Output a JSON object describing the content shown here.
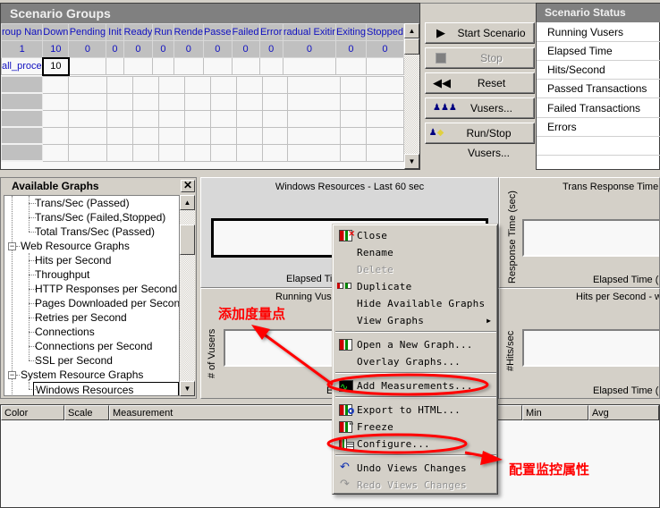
{
  "scenario_groups": {
    "title": "Scenario Groups",
    "columns": [
      "roup Nan",
      "Down",
      "Pending",
      "Init",
      "Ready",
      "Run",
      "Rende",
      "Passe",
      "Failed",
      "Error",
      "radual Exitir",
      "Exiting",
      "Stopped"
    ],
    "totals": [
      "1",
      "10",
      "0",
      "0",
      "0",
      "0",
      "0",
      "0",
      "0",
      "0",
      "0",
      "0",
      "0"
    ],
    "rows": [
      {
        "name": "all_proce",
        "down": "10"
      }
    ]
  },
  "controls": {
    "start": "Start Scenario",
    "stop": "Stop",
    "reset": "Reset",
    "vusers": "Vusers...",
    "run_stop": "Run/Stop Vusers..."
  },
  "scenario_status": {
    "title": "Scenario Status",
    "rows": [
      "Running Vusers",
      "Elapsed Time",
      "Hits/Second",
      "Passed Transactions",
      "Failed Transactions",
      "Errors"
    ]
  },
  "available_graphs": {
    "title": "Available Graphs",
    "close_glyph": "✕",
    "items": [
      {
        "label": "Trans/Sec (Passed)",
        "level": 2
      },
      {
        "label": "Trans/Sec (Failed,Stopped)",
        "level": 2
      },
      {
        "label": "Total Trans/Sec (Passed)",
        "level": 2
      },
      {
        "label": "Web Resource Graphs",
        "level": 1,
        "expanded": true
      },
      {
        "label": "Hits per Second",
        "level": 2
      },
      {
        "label": "Throughput",
        "level": 2
      },
      {
        "label": "HTTP Responses per Second",
        "level": 2
      },
      {
        "label": "Pages Downloaded per Second",
        "level": 2
      },
      {
        "label": "Retries per Second",
        "level": 2
      },
      {
        "label": "Connections",
        "level": 2
      },
      {
        "label": "Connections per Second",
        "level": 2
      },
      {
        "label": "SSL per Second",
        "level": 2
      },
      {
        "label": "System Resource Graphs",
        "level": 1,
        "expanded": true
      },
      {
        "label": "Windows Resources",
        "level": 2,
        "selected": true
      }
    ]
  },
  "graphs": {
    "windows": {
      "title": "Windows Resources - Last 60 sec",
      "xlabel": "Elapsed Tim"
    },
    "trans": {
      "title": "Trans Response Time",
      "ylabel": "Response Time (sec)",
      "xlabel": "Elapsed Time (H"
    },
    "running": {
      "title": "Running Vuse",
      "ylabel": "# of Vusers",
      "xlabel": "Ela"
    },
    "hits": {
      "title": "Hits per Second - w",
      "ylabel": "#Hits/sec",
      "xlabel": "Elapsed Time (H"
    }
  },
  "legend": {
    "columns": [
      "Color",
      "Scale",
      "Measurement",
      "Min",
      "Avg"
    ]
  },
  "context_menu": {
    "items": [
      {
        "label": "Close",
        "icon": "close-graph-icon"
      },
      {
        "label": "Rename"
      },
      {
        "label": "Delete",
        "disabled": true
      },
      {
        "label": "Duplicate",
        "icon": "duplicate-icon"
      },
      {
        "label": "Hide Available Graphs"
      },
      {
        "label": "View Graphs",
        "submenu": true
      },
      {
        "label": "Open a New Graph...",
        "icon": "open-graph-icon"
      },
      {
        "label": "Overlay Graphs..."
      },
      {
        "label": "Add Measurements...",
        "icon": "add-measurements-icon"
      },
      {
        "label": "Export to HTML...",
        "icon": "export-html-icon"
      },
      {
        "label": "Freeze",
        "icon": "freeze-icon"
      },
      {
        "label": "Configure...",
        "icon": "configure-icon"
      },
      {
        "label": "Undo Views Changes",
        "icon": "undo-icon"
      },
      {
        "label": "Redo Views Changes",
        "icon": "redo-icon",
        "disabled": true
      }
    ]
  },
  "annotations": {
    "add_measurement": "添加度量点",
    "configure_props": "配置监控属性",
    "color": "#ff0000"
  }
}
